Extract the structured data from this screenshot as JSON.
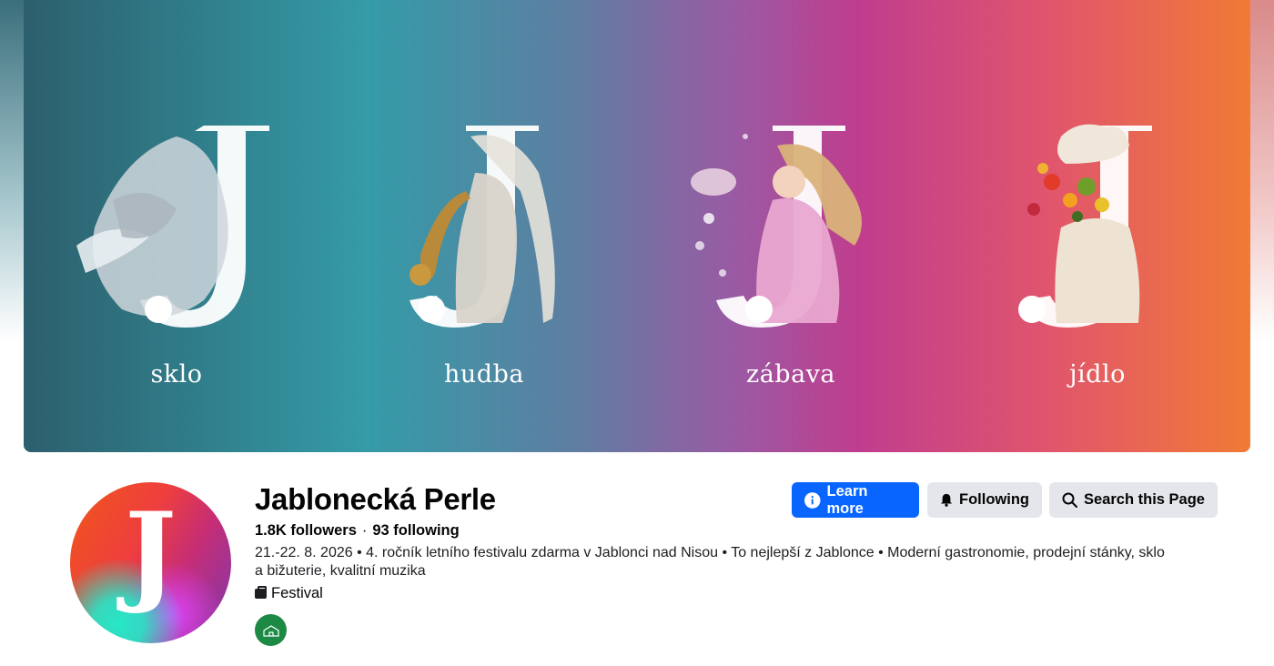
{
  "cover": {
    "panels": [
      {
        "label": "sklo",
        "figure": "glass-woman-illustration"
      },
      {
        "label": "hudba",
        "figure": "saxophonist-illustration"
      },
      {
        "label": "zábava",
        "figure": "girl-blowing-bubbles-illustration"
      },
      {
        "label": "jídlo",
        "figure": "chef-with-food-illustration"
      }
    ]
  },
  "profile": {
    "avatar_letter": "J",
    "name": "Jablonecká Perle",
    "followers": "1.8K followers",
    "following": "93 following",
    "bio": "21.-22. 8. 2026 • 4. ročník letního festivalu zdarma v Jablonci nad Nisou • To nejlepší z Jablonce • Moderní gastronomie, prodejní stánky, sklo a bižuterie, kvalitní muzika",
    "category": "Festival"
  },
  "actions": {
    "learn_more": "Learn more",
    "following": "Following",
    "search": "Search this Page"
  },
  "colors": {
    "primary_button": "#0866ff",
    "secondary_button": "#e4e6eb"
  }
}
